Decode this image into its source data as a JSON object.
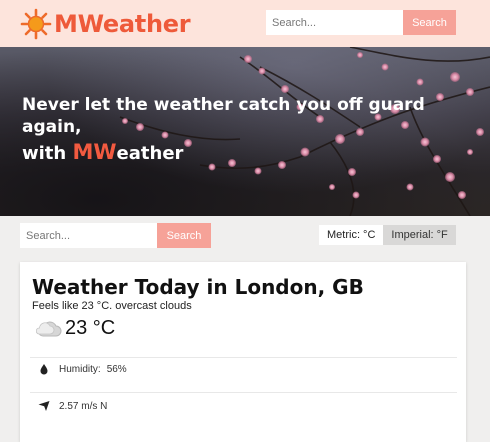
{
  "header": {
    "brand": "MWeather",
    "search_placeholder": "Search...",
    "search_button": "Search"
  },
  "hero": {
    "line1": "Never let the weather catch you off guard",
    "line2": "again,",
    "line3_prefix": "with ",
    "line3_mw": "MW",
    "line3_suffix": "eather"
  },
  "controls": {
    "search_placeholder": "Search...",
    "search_button": "Search",
    "metric_label": "Metric: °C",
    "imperial_label": "Imperial: °F"
  },
  "weather": {
    "title": "Weather Today in London, GB",
    "feels_like": "Feels like 23 °C. overcast clouds",
    "temperature": "23 °C",
    "humidity_label": "Humidity:",
    "humidity_value": "56%",
    "wind": "2.57 m/s N"
  },
  "colors": {
    "brand": "#ee5a3a",
    "header_bg": "#fde4dc",
    "button": "#f6a298"
  },
  "icons": {
    "logo": "sun-icon",
    "weather": "cloud-icon",
    "humidity": "droplet-icon",
    "wind": "wind-direction-icon"
  }
}
